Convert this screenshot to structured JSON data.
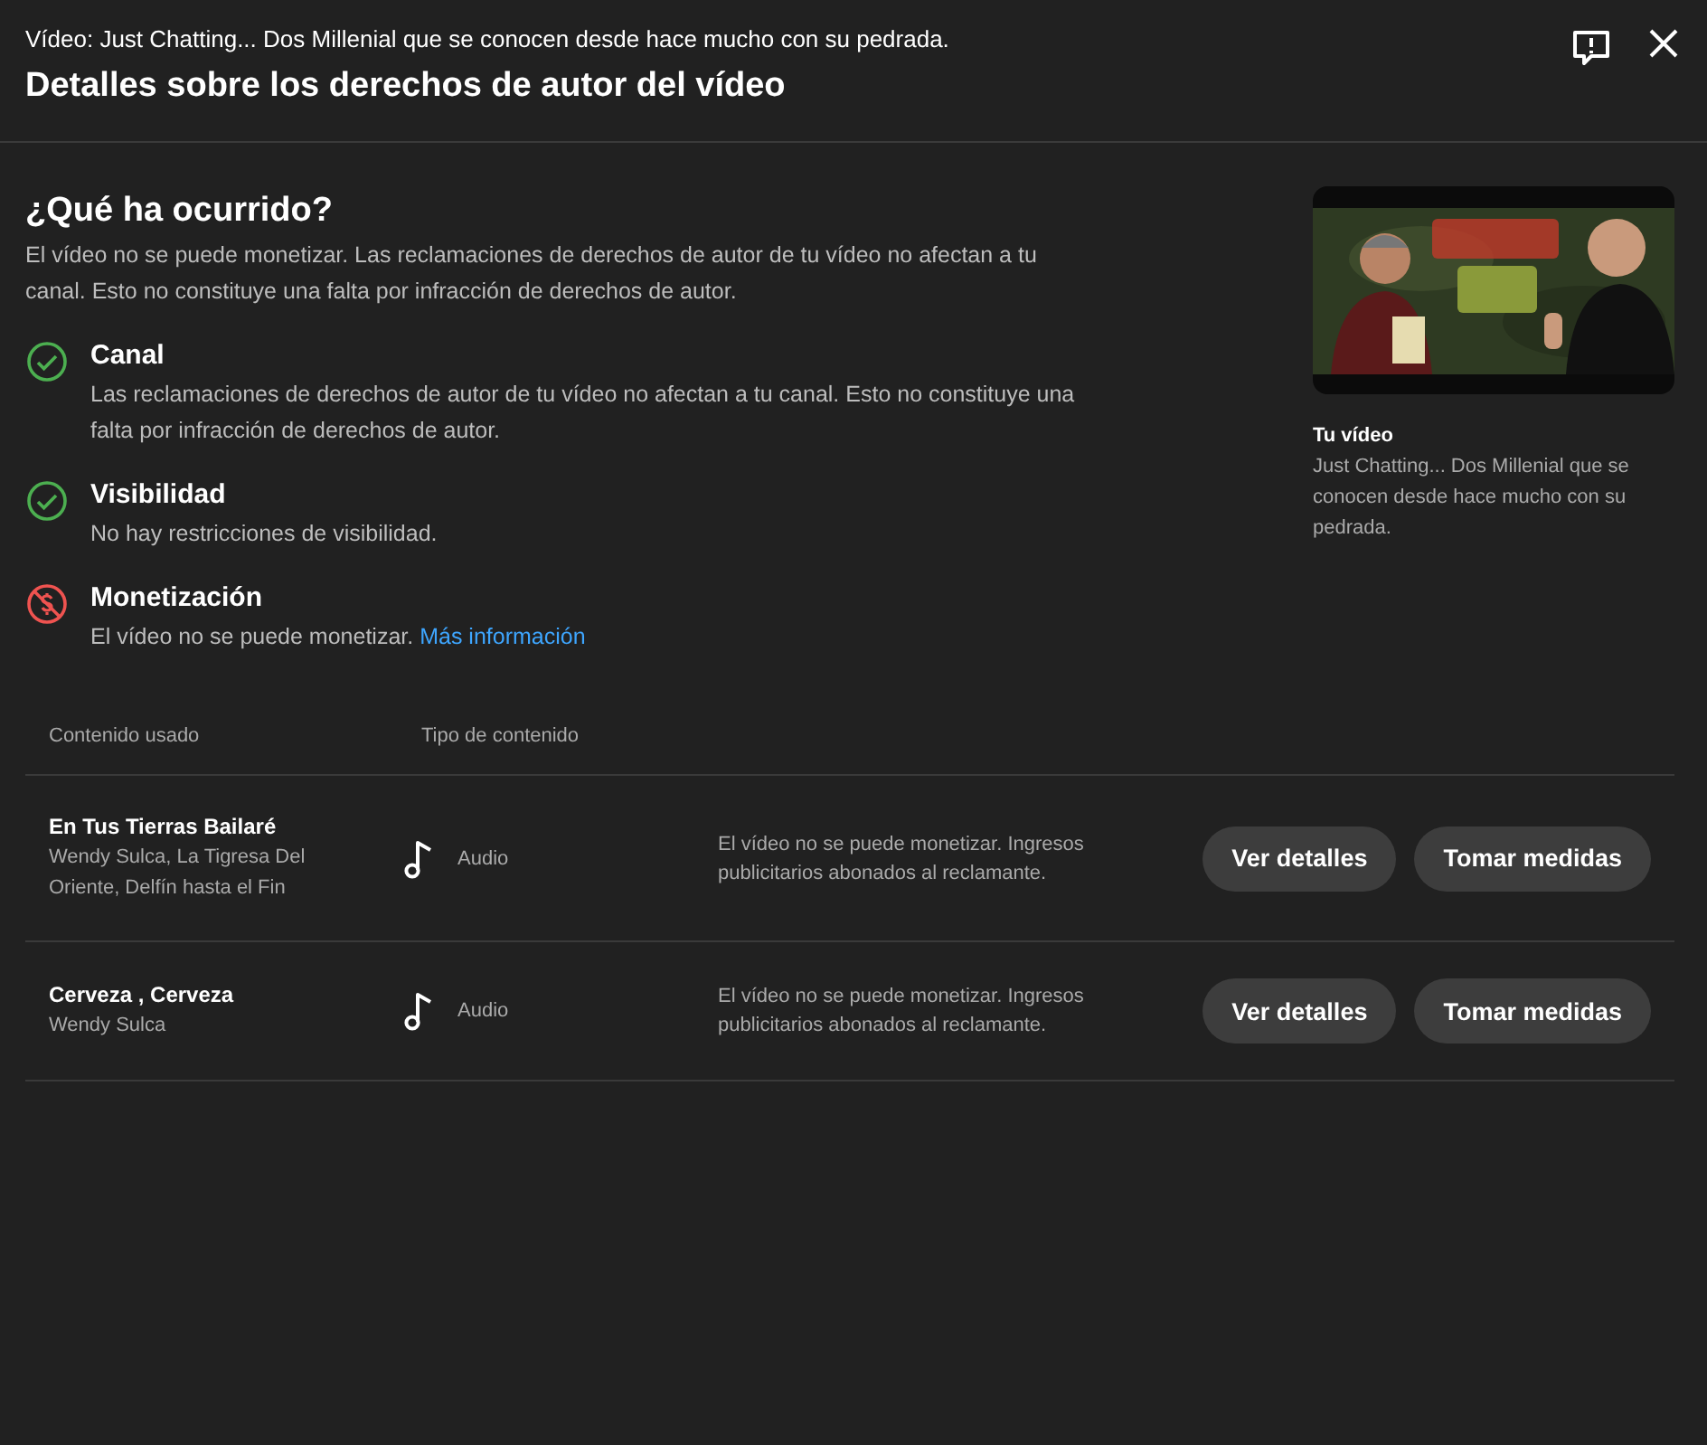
{
  "header": {
    "subtitle": "Vídeo: Just Chatting... Dos Millenial que se conocen desde hace mucho con su pedrada.",
    "title": "Detalles sobre los derechos de autor del vídeo"
  },
  "summary": {
    "heading": "¿Qué ha ocurrido?",
    "text": "El vídeo no se puede monetizar. Las reclamaciones de derechos de autor de tu vídeo no afectan a tu canal. Esto no constituye una falta por infracción de derechos de autor."
  },
  "statuses": [
    {
      "kind": "ok",
      "title": "Canal",
      "text": "Las reclamaciones de derechos de autor de tu vídeo no afectan a tu canal. Esto no constituye una falta por infracción de derechos de autor."
    },
    {
      "kind": "ok",
      "title": "Visibilidad",
      "text": "No hay restricciones de visibilidad."
    },
    {
      "kind": "blocked",
      "title": "Monetización",
      "text": "El vídeo no se puede monetizar.",
      "link": "Más información"
    }
  ],
  "video": {
    "label": "Tu vídeo",
    "title": "Just Chatting... Dos Millenial que se conocen desde hace mucho con su pedrada."
  },
  "table": {
    "columns": [
      "Contenido usado",
      "Tipo de contenido"
    ],
    "rows": [
      {
        "title": "En Tus Tierras Bailaré",
        "artists": "Wendy Sulca, La Tigresa Del Oriente, Delfín hasta el Fin",
        "type": "Audio",
        "impact": "El vídeo no se puede monetizar. Ingresos publicitarios abonados al reclamante.",
        "buttons": [
          "Ver detalles",
          "Tomar medidas"
        ]
      },
      {
        "title": "Cerveza , Cerveza",
        "artists": "Wendy Sulca",
        "type": "Audio",
        "impact": "El vídeo no se puede monetizar. Ingresos publicitarios abonados al reclamante.",
        "buttons": [
          "Ver detalles",
          "Tomar medidas"
        ]
      }
    ]
  }
}
